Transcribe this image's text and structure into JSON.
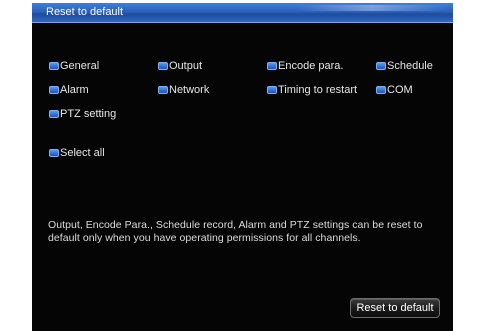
{
  "dialog": {
    "title": "Reset to default"
  },
  "options": [
    {
      "label": "General",
      "checked": true
    },
    {
      "label": "Output",
      "checked": true
    },
    {
      "label": "Encode para.",
      "checked": true
    },
    {
      "label": "Schedule",
      "checked": true
    },
    {
      "label": "Alarm",
      "checked": true
    },
    {
      "label": "Network",
      "checked": true
    },
    {
      "label": "Timing to restart",
      "checked": true
    },
    {
      "label": "COM",
      "checked": true
    },
    {
      "label": "PTZ setting",
      "checked": true
    }
  ],
  "select_all": {
    "label": "Select all",
    "checked": true
  },
  "note": "Output, Encode Para., Schedule record, Alarm and PTZ settings can be reset to default only when you have operating permissions for all channels.",
  "button": {
    "label": "Reset to default"
  },
  "colors": {
    "titlebar": "#2a5fb8",
    "background": "#050505",
    "checkbox": "#2d6ed6"
  },
  "icons": {
    "checkbox": "blue-checkbox-icon"
  }
}
